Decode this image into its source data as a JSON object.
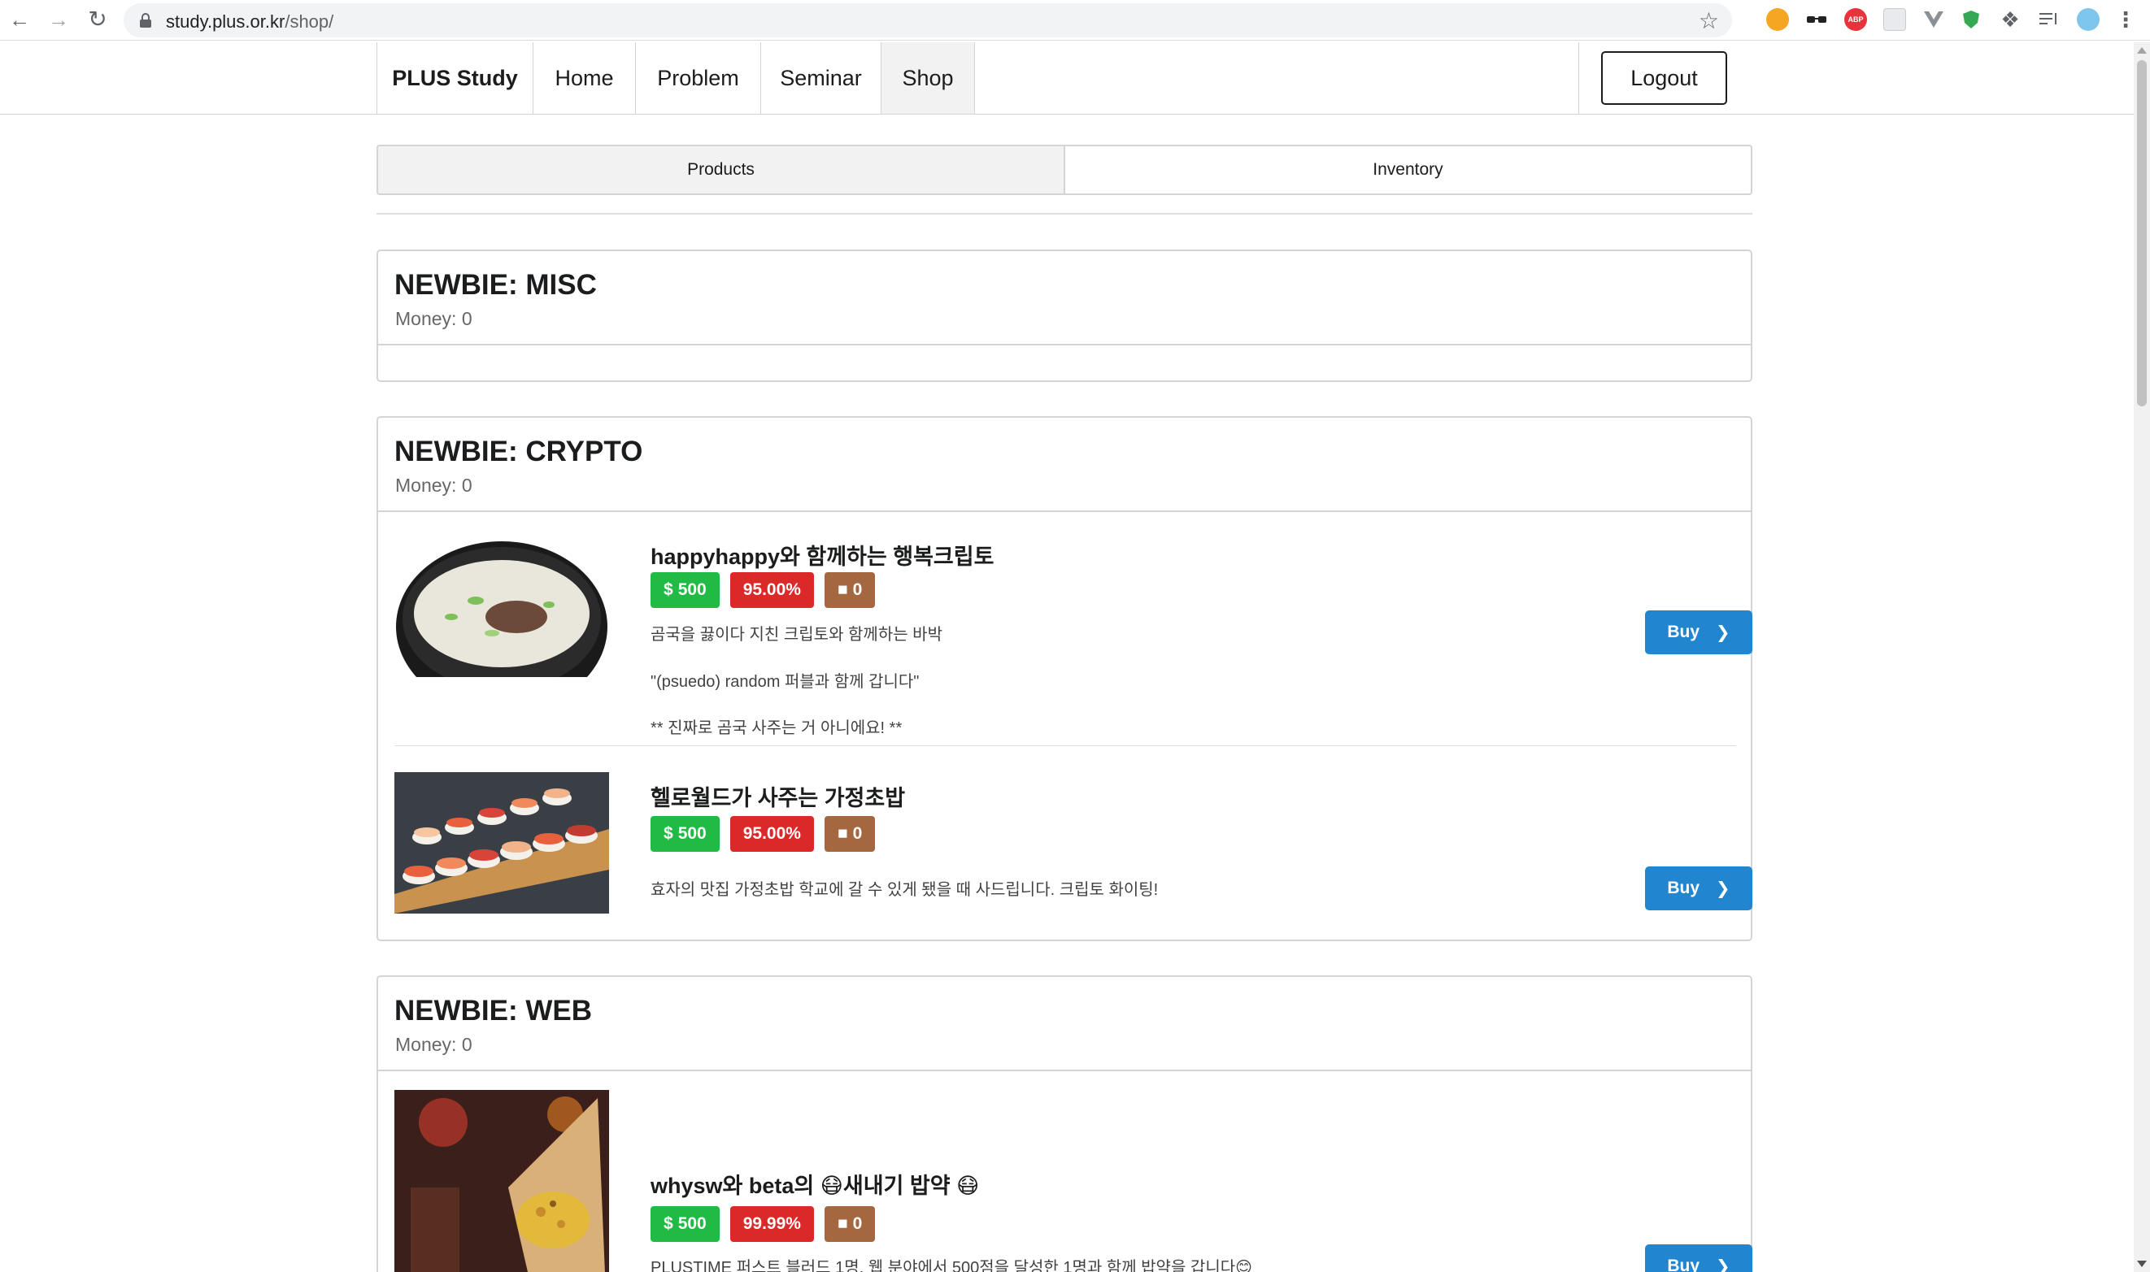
{
  "browser": {
    "url_host": "study.plus.or.kr",
    "url_path": "/shop/"
  },
  "menu": {
    "brand": "PLUS Study",
    "items": [
      "Home",
      "Problem",
      "Seminar",
      "Shop"
    ],
    "active": "Shop",
    "logout": "Logout"
  },
  "tabs": {
    "products": "Products",
    "inventory": "Inventory",
    "active": "Products"
  },
  "sections": [
    {
      "title": "NEWBIE: MISC",
      "money": "Money: 0",
      "items": []
    },
    {
      "title": "NEWBIE: CRYPTO",
      "money": "Money: 0",
      "items": [
        {
          "name": "happyhappy와 함께하는 행복크립토",
          "price": "500",
          "rate": "95.00%",
          "stock": "0",
          "desc": [
            "곰국을 끓이다 지친 크립토와 함께하는 바박",
            "\"(psuedo) random 퍼블과 함께 갑니다\"",
            "** 진짜로 곰국 사주는 거 아니에요! **"
          ],
          "buy": "Buy",
          "image": "gomguk-soup"
        },
        {
          "name": "헬로월드가 사주는 가정초밥",
          "price": "500",
          "rate": "95.00%",
          "stock": "0",
          "desc": [
            "효자의 맛집 가정초밥 학교에 갈 수 있게 됐을 때 사드립니다. 크립토 화이팅!"
          ],
          "buy": "Buy",
          "image": "sushi-platter"
        }
      ]
    },
    {
      "title": "NEWBIE: WEB",
      "money": "Money: 0",
      "items": [
        {
          "name": "whysw와 beta의 😷새내기 밥약 😷",
          "price": "500",
          "rate": "99.99%",
          "stock": "0",
          "desc": [
            "PLUSTIME 퍼스트 블러드 1명, 웹 분야에서 500점을 달성한 1명과 함께 밥약을 갑니다😊"
          ],
          "buy": "Buy",
          "image": "food-cone"
        }
      ]
    }
  ],
  "colors": {
    "price": "#21ba45",
    "rate": "#db2828",
    "stock": "#a5673f",
    "buy": "#2185d0"
  },
  "icons": {
    "dollar": "dollar-icon",
    "percent": "percent-icon",
    "archive": "archive-icon",
    "chevron": "chevron-right-icon"
  }
}
